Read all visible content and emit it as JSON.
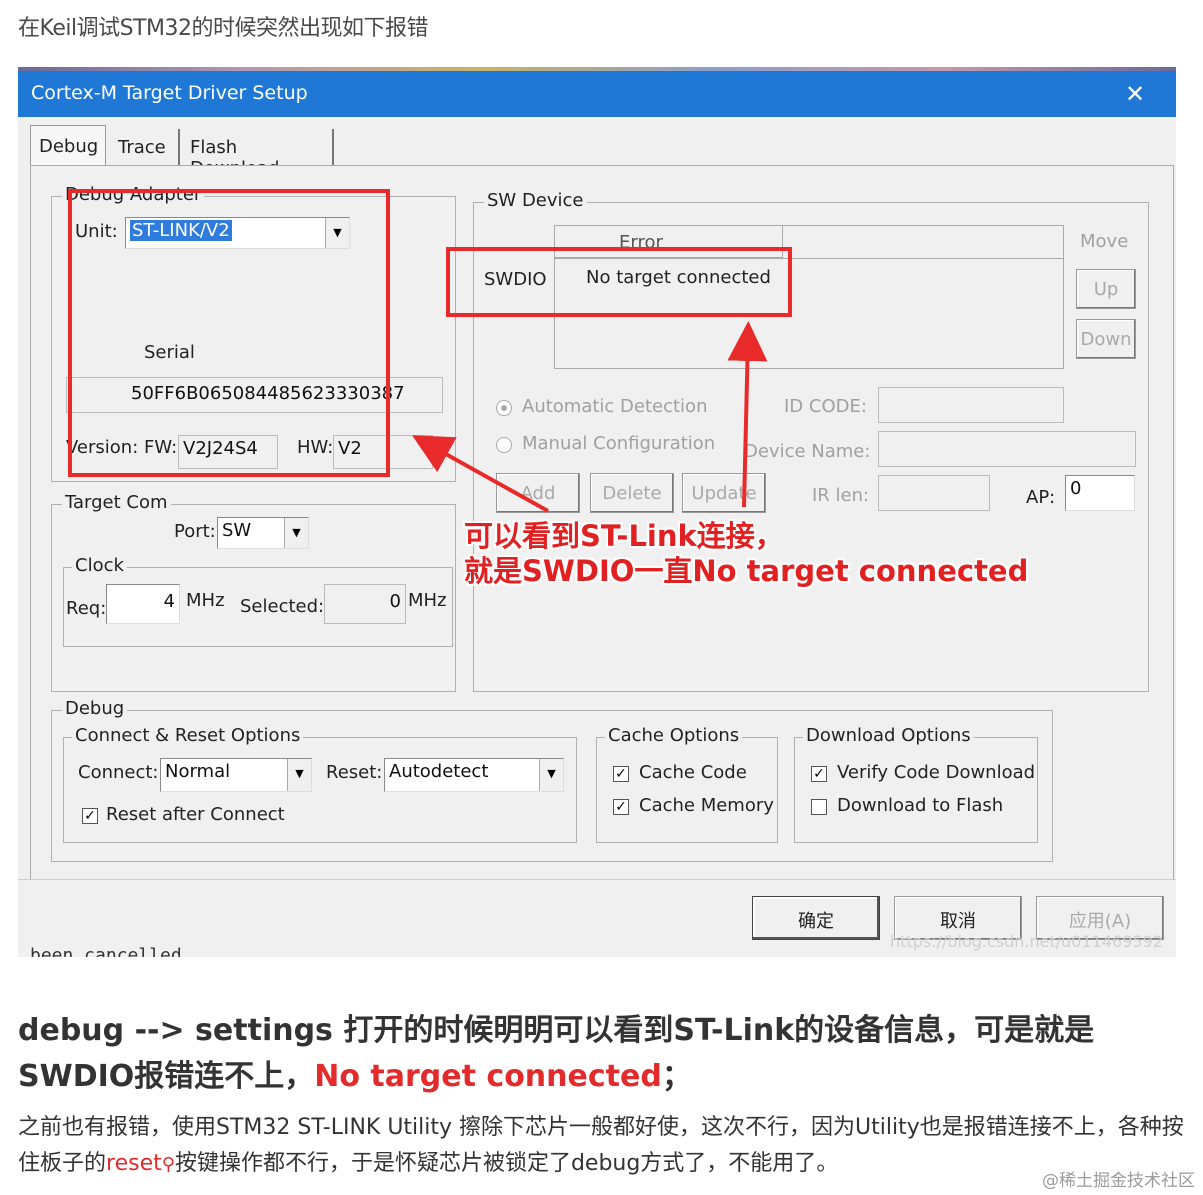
{
  "intro_text": "在Keil调试STM32的时候突然出现如下报错",
  "dialog": {
    "title": "Cortex-M Target Driver Setup",
    "close_glyph": "✕",
    "tabs": [
      "Debug",
      "Trace",
      "Flash Download"
    ],
    "debug_adapter": {
      "group_label": "Debug Adapter",
      "unit_label": "Unit:",
      "unit_value": "ST-LINK/V2",
      "serial_label": "Serial",
      "serial_value": "50FF6B065084485623330387",
      "version_label": "Version: FW:",
      "fw_value": "V2J24S4",
      "hw_label": "HW:",
      "hw_value": "V2"
    },
    "target_com": {
      "group_label": "Target Com",
      "port_label": "Port:",
      "port_value": "SW",
      "clock_label": "Clock",
      "req_label": "Req:",
      "req_value": "4",
      "mhz_label": "MHz",
      "selected_label": "Selected:",
      "selected_value": "0",
      "mhz_label2": "MHz"
    },
    "sw_device": {
      "group_label": "SW Device",
      "error_header": "Error",
      "row_label": "SWDIO",
      "row_value": "No target connected",
      "move_label": "Move",
      "up_label": "Up",
      "down_label": "Down",
      "auto_detect_label": "Automatic Detection",
      "manual_config_label": "Manual Configuration",
      "id_code_label": "ID CODE:",
      "device_name_label": "Device Name:",
      "ir_len_label": "IR len:",
      "ap_label": "AP:",
      "ap_value": "0",
      "add_label": "Add",
      "delete_label": "Delete",
      "update_label": "Update"
    },
    "debug_group": {
      "group_label": "Debug",
      "connect_reset_label": "Connect & Reset Options",
      "connect_label": "Connect:",
      "connect_value": "Normal",
      "reset_label": "Reset:",
      "reset_value": "Autodetect",
      "reset_after_connect": "Reset after Connect",
      "cache_options_label": "Cache Options",
      "cache_code": "Cache Code",
      "cache_memory": "Cache Memory",
      "download_options_label": "Download Options",
      "verify_code_download": "Verify Code Download",
      "download_to_flash": "Download to Flash"
    },
    "buttons": {
      "ok": "确定",
      "cancel": "取消",
      "apply": "应用(A)"
    },
    "overlay_url": "https://blog.csdn.net/u011469592",
    "cancelled_text": "been cancelled"
  },
  "annotation": {
    "line1": "可以看到ST-Link连接，",
    "line2": "就是SWDIO一直No target connected",
    "color": "#e12121"
  },
  "heading": {
    "part1": "debug --> settings 打开的时候明明可以看到ST-Link的设备信息，可是就是SWDIO报错连不上，",
    "highlight": "No target connected",
    "part2": "；"
  },
  "paragraph": {
    "part1": "之前也有报错，使用STM32 ST-LINK Utility 擦除下芯片一般都好使，这次不行，因为Utility也是报错连接不上，各种按住板子的",
    "link": "reset",
    "part2": "按键操作都不行，于是怀疑芯片被锁定了debug方式了，不能用了。"
  },
  "site_watermark": "@稀土掘金技术社区"
}
